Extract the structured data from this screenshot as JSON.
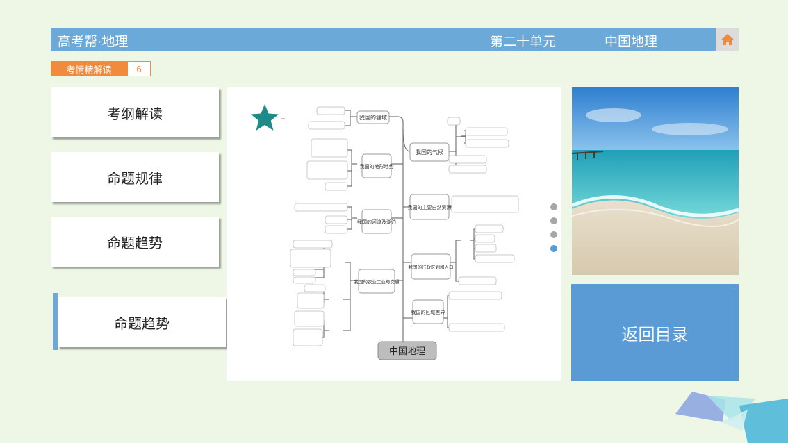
{
  "header": {
    "brand": "高考帮·地理",
    "unit": "第二十单元",
    "subject": "中国地理",
    "home_icon": "home-icon"
  },
  "tag": {
    "label": "考情精解读",
    "page": "6"
  },
  "sidebar": {
    "items": [
      {
        "label": "考纲解读"
      },
      {
        "label": "命题规律"
      },
      {
        "label": "命题趋势"
      },
      {
        "label": "命题趋势"
      }
    ]
  },
  "mindmap": {
    "root": "中国地理",
    "left_branches": [
      "我国的疆域",
      "我国的地形地势",
      "我国的河流及湖泊",
      "我国的农业工业与交通"
    ],
    "right_branches": [
      "我国的气候",
      "我国的主要自然资源",
      "我国的行政区划和人口",
      "我国的区域差异"
    ]
  },
  "pager": {
    "count": 4,
    "active": 3
  },
  "return_button": {
    "label": "返回目录"
  },
  "colors": {
    "bar": "#6aa9d8",
    "accent": "#f08a3c",
    "button": "#5b9bd5",
    "star": "#1f8a8a"
  }
}
